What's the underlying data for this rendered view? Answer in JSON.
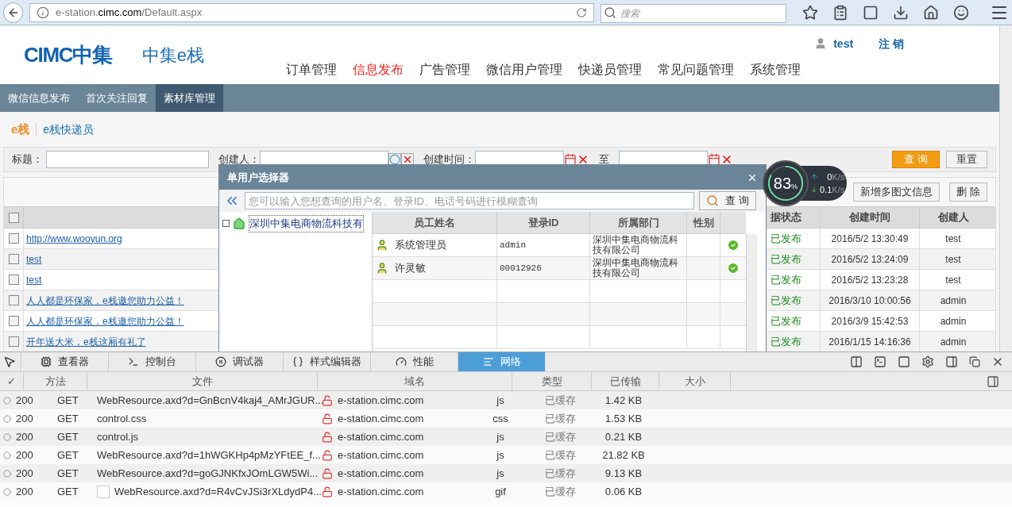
{
  "browser": {
    "url_host_pre": "e-station.",
    "url_host": "cimc.com",
    "url_path": "/Default.aspx",
    "search_placeholder": "搜索"
  },
  "header": {
    "logo": "CIMC中集",
    "site_name": "中集e栈",
    "user": "test",
    "logout": "注 销",
    "nav": [
      {
        "label": "订单管理",
        "selected": false
      },
      {
        "label": "信息发布",
        "selected": true
      },
      {
        "label": "广告管理",
        "selected": false
      },
      {
        "label": "微信用户管理",
        "selected": false
      },
      {
        "label": "快递员管理",
        "selected": false
      },
      {
        "label": "常见问题管理",
        "selected": false
      },
      {
        "label": "系统管理",
        "selected": false
      }
    ]
  },
  "subnav": [
    {
      "label": "微信信息发布",
      "selected": false
    },
    {
      "label": "首次关注回复",
      "selected": false
    },
    {
      "label": "素材库管理",
      "selected": true
    }
  ],
  "breadcrumb": {
    "current": "e栈",
    "link": "e栈快递员"
  },
  "filters": {
    "title_label": "标题：",
    "creator_label": "创建人：",
    "time_label": "创建时间：",
    "to_label": "至",
    "search_button": "查 询",
    "reset_button": "重置"
  },
  "actions": [
    "新增多图文信息",
    "删 除"
  ],
  "table": {
    "header_checked": false,
    "columns": [
      "据状态",
      "创建时间",
      "创建人"
    ],
    "rows": [
      {
        "checked": false,
        "title": "http://www.wooyun.org",
        "status": "已发布",
        "time": "2016/5/2 13:30:49",
        "creator": "test"
      },
      {
        "checked": false,
        "title": "test",
        "status": "已发布",
        "time": "2016/5/2 13:24:09",
        "creator": "test"
      },
      {
        "checked": false,
        "title": "test",
        "status": "已发布",
        "time": "2016/5/2 13:23:28",
        "creator": "test"
      },
      {
        "checked": false,
        "title": "人人都是环保家，e栈邀您助力公益！",
        "status": "已发布",
        "time": "2016/3/10 10:00:56",
        "creator": "admin"
      },
      {
        "checked": false,
        "title": "人人都是环保家，e栈邀您助力公益！",
        "status": "已发布",
        "time": "2016/3/9 15:42:53",
        "creator": "admin"
      },
      {
        "checked": false,
        "title": "开年送大米，e栈这厢有礼了",
        "status": "已发布",
        "time": "2016/1/15 14:16:36",
        "creator": "admin"
      }
    ]
  },
  "dialog": {
    "title": "单用户选择器",
    "search_placeholder": "您可以输入您想查询的用户名、登录ID、电话号码进行模糊查询",
    "search_button": "查 询",
    "tree": [
      {
        "label": "深圳中集电商物流科技有",
        "expanded": false
      }
    ],
    "columns": [
      "员工姓名",
      "登录ID",
      "所属部门",
      "性别"
    ],
    "rows": [
      {
        "name": "系统管理员",
        "login_id": "admin",
        "department": "深圳中集电商物流科技有限公司",
        "selectable": true
      },
      {
        "name": "许灵敏",
        "login_id": "00012926",
        "department": "深圳中集电商物流科技有限公司",
        "selectable": true
      }
    ]
  },
  "speed_widget": {
    "percent": "83",
    "percent_unit": "%",
    "level": 0.83,
    "up": "0",
    "down": "0.1",
    "unit_up": "K/s",
    "unit_down": "K/s"
  },
  "devtools": {
    "tabs": [
      {
        "label": "查看器",
        "selected": false
      },
      {
        "label": "控制台",
        "selected": false
      },
      {
        "label": "调试器",
        "selected": false
      },
      {
        "label": "样式编辑器",
        "selected": false
      },
      {
        "label": "性能",
        "selected": false
      },
      {
        "label": "网络",
        "selected": true
      }
    ],
    "columns": [
      "✓",
      "方法",
      "文件",
      "域名",
      "类型",
      "已传输",
      "大小"
    ],
    "rows": [
      {
        "status": "200",
        "method": "GET",
        "file": "WebResource.axd?d=GnBcnV4kaj4_AMrJGUR...",
        "preview": false,
        "domain": "e-station.cimc.com",
        "type": "js",
        "transferred": "已缓存",
        "size": "1.42 KB"
      },
      {
        "status": "200",
        "method": "GET",
        "file": "control.css",
        "preview": false,
        "domain": "e-station.cimc.com",
        "type": "css",
        "transferred": "已缓存",
        "size": "1.53 KB"
      },
      {
        "status": "200",
        "method": "GET",
        "file": "control.js",
        "preview": false,
        "domain": "e-station.cimc.com",
        "type": "js",
        "transferred": "已缓存",
        "size": "0.21 KB"
      },
      {
        "status": "200",
        "method": "GET",
        "file": "WebResource.axd?d=1hWGKHp4pMzYFtEE_f...",
        "preview": false,
        "domain": "e-station.cimc.com",
        "type": "js",
        "transferred": "已缓存",
        "size": "21.82 KB"
      },
      {
        "status": "200",
        "method": "GET",
        "file": "WebResource.axd?d=goGJNKfxJOmLGW5Wi...",
        "preview": false,
        "domain": "e-station.cimc.com",
        "type": "js",
        "transferred": "已缓存",
        "size": "9.13 KB"
      },
      {
        "status": "200",
        "method": "GET",
        "file": "WebResource.axd?d=R4vCvJSi3rXLdydP4...",
        "preview": true,
        "domain": "e-station.cimc.com",
        "type": "gif",
        "transferred": "已缓存",
        "size": "0.06 KB"
      }
    ]
  }
}
